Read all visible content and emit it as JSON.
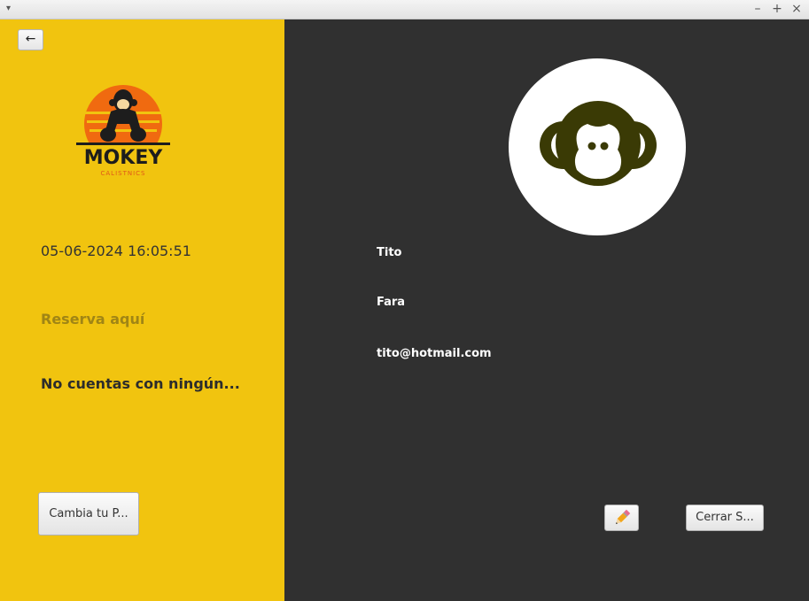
{
  "window": {
    "menu_glyph": "▾",
    "controls": {
      "minimize": "–",
      "maximize": "+",
      "close": "×"
    }
  },
  "left": {
    "back_label": "←",
    "logo": {
      "brand": "MOKEY",
      "tagline": "CALISTNICS",
      "icon": "monkey-logo"
    },
    "datetime": "05-06-2024 16:05:51",
    "reserva_link": "Reserva aquí",
    "no_cuentas": "No cuentas con ningún...",
    "change_button": "Cambia tu P..."
  },
  "profile": {
    "avatar_icon": "monkey-face-icon",
    "first_name": "Tito",
    "last_name": "Fara",
    "email": "tito@hotmail.com",
    "edit_icon": "pencil-icon",
    "logout_button": "Cerrar S..."
  },
  "colors": {
    "left_bg": "#f1c40f",
    "right_bg": "#303030",
    "monkey": "#3a3a05",
    "logo_sun": "#f06a10"
  }
}
